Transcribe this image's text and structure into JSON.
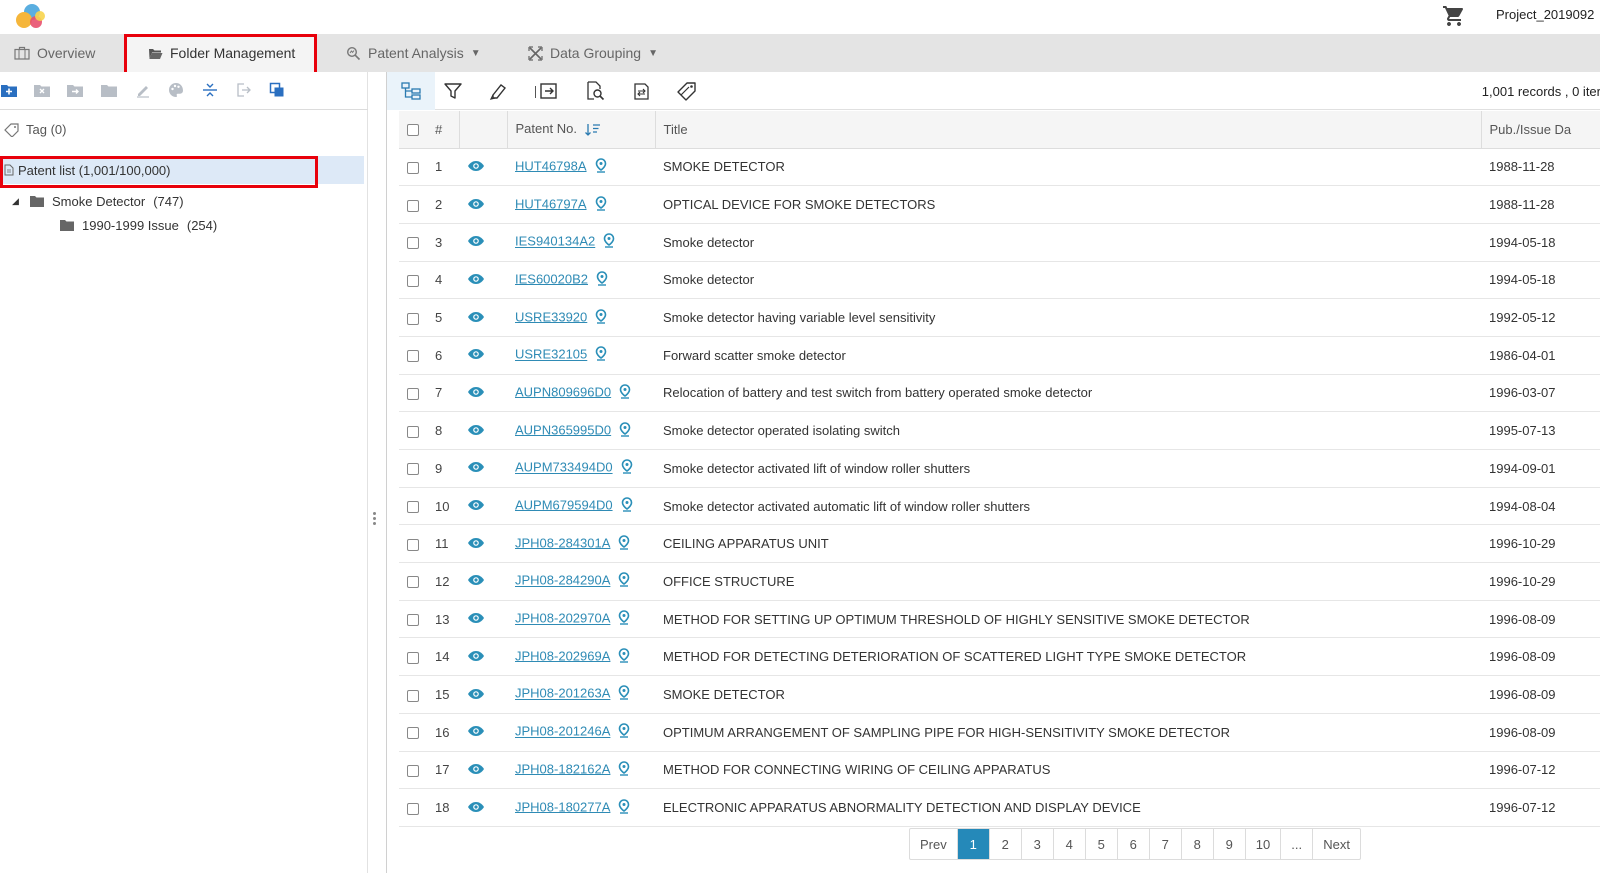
{
  "header": {
    "project_name": "Project_2019092"
  },
  "nav": {
    "tabs": [
      {
        "label": "Overview",
        "icon": "briefcase-icon"
      },
      {
        "label": "Folder Management",
        "icon": "folder-open-icon",
        "active": true
      },
      {
        "label": "Patent Analysis",
        "icon": "analysis-icon",
        "dropdown": true
      },
      {
        "label": "Data Grouping",
        "icon": "grouping-icon",
        "dropdown": true
      }
    ]
  },
  "sidebar": {
    "tag_label": "Tag (0)",
    "patent_list_label": "Patent list (1,001/100,000)",
    "tree": [
      {
        "label": "Smoke Detector",
        "count": "(747)"
      },
      {
        "label": "1990-1999 Issue",
        "count": "(254)"
      }
    ]
  },
  "toolbar": {
    "records_text": "1,001 records , 0 iter"
  },
  "table": {
    "columns": [
      "#",
      "Patent No.",
      "Title",
      "Pub./Issue Da"
    ],
    "rows": [
      {
        "num": "1",
        "patent": "HUT46798A",
        "title": "SMOKE DETECTOR",
        "date": "1988-11-28"
      },
      {
        "num": "2",
        "patent": "HUT46797A",
        "title": "OPTICAL DEVICE FOR SMOKE DETECTORS",
        "date": "1988-11-28"
      },
      {
        "num": "3",
        "patent": "IES940134A2",
        "title": "Smoke detector",
        "date": "1994-05-18"
      },
      {
        "num": "4",
        "patent": "IES60020B2",
        "title": "Smoke detector",
        "date": "1994-05-18"
      },
      {
        "num": "5",
        "patent": "USRE33920",
        "title": "Smoke detector having variable level sensitivity",
        "date": "1992-05-12"
      },
      {
        "num": "6",
        "patent": "USRE32105",
        "title": "Forward scatter smoke detector",
        "date": "1986-04-01"
      },
      {
        "num": "7",
        "patent": "AUPN809696D0",
        "title": "Relocation of battery and test switch from battery operated smoke detector",
        "date": "1996-03-07"
      },
      {
        "num": "8",
        "patent": "AUPN365995D0",
        "title": "Smoke detector operated isolating switch",
        "date": "1995-07-13"
      },
      {
        "num": "9",
        "patent": "AUPM733494D0",
        "title": "Smoke detector activated lift of window roller shutters",
        "date": "1994-09-01"
      },
      {
        "num": "10",
        "patent": "AUPM679594D0",
        "title": "Smoke detector activated automatic lift of window roller shutters",
        "date": "1994-08-04"
      },
      {
        "num": "11",
        "patent": "JPH08-284301A",
        "title": "CEILING APPARATUS UNIT",
        "date": "1996-10-29"
      },
      {
        "num": "12",
        "patent": "JPH08-284290A",
        "title": "OFFICE STRUCTURE",
        "date": "1996-10-29"
      },
      {
        "num": "13",
        "patent": "JPH08-202970A",
        "title": "METHOD FOR SETTING UP OPTIMUM THRESHOLD OF HIGHLY SENSITIVE SMOKE DETECTOR",
        "date": "1996-08-09"
      },
      {
        "num": "14",
        "patent": "JPH08-202969A",
        "title": "METHOD FOR DETECTING DETERIORATION OF SCATTERED LIGHT TYPE SMOKE DETECTOR",
        "date": "1996-08-09"
      },
      {
        "num": "15",
        "patent": "JPH08-201263A",
        "title": "SMOKE DETECTOR",
        "date": "1996-08-09"
      },
      {
        "num": "16",
        "patent": "JPH08-201246A",
        "title": "OPTIMUM ARRANGEMENT OF SAMPLING PIPE FOR HIGH-SENSITIVITY SMOKE DETECTOR",
        "date": "1996-08-09"
      },
      {
        "num": "17",
        "patent": "JPH08-182162A",
        "title": "METHOD FOR CONNECTING WIRING OF CEILING APPARATUS",
        "date": "1996-07-12"
      },
      {
        "num": "18",
        "patent": "JPH08-180277A",
        "title": "ELECTRONIC APPARATUS ABNORMALITY DETECTION AND DISPLAY DEVICE",
        "date": "1996-07-12"
      }
    ]
  },
  "pagination": {
    "prev": "Prev",
    "pages": [
      "1",
      "2",
      "3",
      "4",
      "5",
      "6",
      "7",
      "8",
      "9",
      "10",
      "..."
    ],
    "active": "1",
    "next": "Next"
  },
  "colors": {
    "accent": "#2589b9",
    "link": "#2f8bb5",
    "highlight_box": "#e8000b",
    "selected_row": "#dde9f7"
  }
}
